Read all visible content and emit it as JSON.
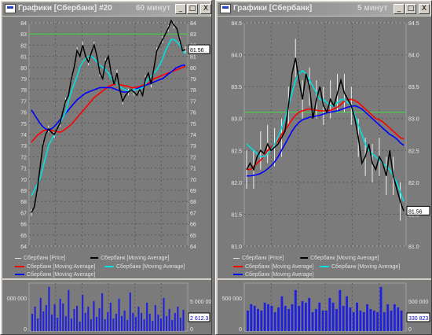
{
  "windows": [
    {
      "title": "Графики [Сбербанк] #20",
      "subtitle": "60 минут",
      "buttons": [
        "_",
        "□",
        "X"
      ],
      "price_label": "81.56",
      "volume_label": "2 612.3",
      "legend": [
        {
          "text": "Сбербанк [Price]",
          "color": "#e0e0e0"
        },
        {
          "text": "Сбербанк [Moving Average]",
          "color": "#000000"
        },
        {
          "text": "Сбербанк [Moving Average]",
          "color": "#ff0000"
        },
        {
          "text": "Сбербанк [Moving Average]",
          "color": "#00e0e0"
        },
        {
          "text": "Сбербанк [Moving Average]",
          "color": "#0000ff"
        }
      ],
      "volume_ticks_left": [
        "000 000",
        "0"
      ],
      "volume_ticks_right": [
        "5 000 00",
        "0"
      ]
    },
    {
      "title": "Графики [Сбербанк]",
      "subtitle": "5 минут",
      "buttons": [
        "_",
        "□",
        "X"
      ],
      "price_label": "81.56",
      "volume_label": "330 823",
      "legend": [
        {
          "text": "Сбербанк [Price]",
          "color": "#e0e0e0"
        },
        {
          "text": "Сбербанк [Moving Average]",
          "color": "#000000"
        },
        {
          "text": "Сбербанк [Moving Average]",
          "color": "#ff0000"
        },
        {
          "text": "Сбербанк [Moving Average]",
          "color": "#00e0e0"
        },
        {
          "text": "Сбербанк [Moving Average]",
          "color": "#0000ff"
        }
      ],
      "volume_ticks_left": [
        "500 000",
        "0"
      ],
      "volume_ticks_right": [
        "500 000",
        "0"
      ]
    }
  ],
  "chart_data": [
    {
      "type": "line",
      "ylim": [
        64,
        84
      ],
      "yticks": [
        "84",
        "83",
        "82",
        "81",
        "80",
        "79",
        "78",
        "77",
        "76",
        "75",
        "74",
        "73",
        "72",
        "71",
        "70",
        "69",
        "68",
        "67",
        "66",
        "65",
        "64"
      ],
      "hline": 83,
      "series": [
        {
          "color": "#000000",
          "values": [
            67,
            67.5,
            69,
            71,
            73,
            74,
            74.5,
            74.2,
            74,
            74.5,
            75,
            76,
            77,
            77.5,
            79,
            80,
            81.5,
            81,
            82,
            81,
            80.5,
            81.3,
            82,
            81,
            79.5,
            79,
            80.5,
            81,
            79.5,
            78.5,
            79.5,
            78,
            77,
            77.5,
            77.8,
            78,
            77.8,
            77.5,
            78,
            77.5,
            79,
            79.5,
            78.5,
            80,
            81.5,
            82,
            82.5,
            83,
            83.5,
            84.2,
            83.8,
            83.5,
            82.5,
            81.5,
            81.6
          ]
        },
        {
          "color": "#00e0e0",
          "values": [
            68.5,
            69,
            69.5,
            70,
            71,
            72,
            73,
            73.5,
            74,
            74.5,
            75,
            75.5,
            76,
            77,
            77.8,
            78.5,
            79.2,
            80,
            80.5,
            80.8,
            81,
            81,
            80.8,
            80.5,
            80.2,
            80,
            79.8,
            79.5,
            79,
            78.8,
            78.5,
            78.3,
            78.1,
            78,
            77.9,
            77.9,
            78,
            78,
            78.1,
            78.2,
            78.5,
            79,
            79.2,
            79.5,
            79.8,
            80.2,
            80.8,
            81.5,
            82,
            82.5,
            82.5,
            82.3,
            82,
            81.6,
            81.2
          ]
        },
        {
          "color": "#ff0000",
          "values": [
            73.3,
            73.6,
            73.9,
            74.1,
            74.3,
            74.4,
            74.4,
            74.35,
            74.3,
            74.25,
            74.2,
            74.3,
            74.5,
            74.7,
            74.9,
            75.2,
            75.5,
            75.8,
            76.1,
            76.4,
            76.7,
            77,
            77.3,
            77.5,
            77.7,
            77.9,
            78.1,
            78.3,
            78.4,
            78.5,
            78.5,
            78.45,
            78.4,
            78.35,
            78.3,
            78.2,
            78.2,
            78.25,
            78.3,
            78.4,
            78.5,
            78.6,
            78.8,
            79,
            79.1,
            79.2,
            79.3,
            79.4,
            79.5,
            79.6,
            79.7,
            79.8,
            79.9,
            80,
            80.1
          ]
        },
        {
          "color": "#0000ff",
          "values": [
            76.2,
            75.8,
            75.4,
            75,
            74.7,
            74.5,
            74.4,
            74.5,
            74.7,
            75,
            75.3,
            75.6,
            75.9,
            76.2,
            76.5,
            76.8,
            77.1,
            77.3,
            77.5,
            77.7,
            77.8,
            77.9,
            78,
            78.1,
            78.2,
            78.2,
            78.2,
            78.2,
            78.2,
            78.1,
            78,
            77.9,
            77.8,
            77.8,
            77.85,
            77.9,
            78,
            78.1,
            78.2,
            78.3,
            78.4,
            78.5,
            78.6,
            78.7,
            78.8,
            78.9,
            79,
            79.2,
            79.4,
            79.6,
            79.8,
            80,
            80.1,
            80.2,
            80.2
          ]
        }
      ],
      "volume": [
        2.2,
        3.1,
        1.6,
        4.2,
        2.5,
        3.3,
        5.6,
        2.1,
        3.4,
        1.7,
        4.1,
        3.5,
        1.9,
        5.2,
        1.6,
        2.8,
        3.2,
        1.2,
        4.6,
        2.3,
        3.1,
        1.5,
        3.8,
        1.8,
        2.9,
        4.8,
        1.5,
        2.4,
        3.6,
        1.6,
        2.2,
        4.1,
        1.9,
        2.6,
        1.4,
        4.9,
        2.3,
        1.8,
        3.1,
        2.3,
        1.5,
        3.6,
        2.2,
        1.3,
        3.3,
        2.1,
        1.6,
        4.2,
        1.9,
        2.8,
        1.4,
        2.3,
        3.1,
        1.7,
        2.7
      ]
    },
    {
      "type": "line",
      "ylim": [
        81.0,
        84.5
      ],
      "yticks": [
        "84.5",
        "84.0",
        "83.5",
        "83.0",
        "82.5",
        "82.0",
        "81.5",
        "81.0"
      ],
      "hline": 83.1,
      "series": [
        {
          "color": "#000000",
          "values": [
            82.2,
            82.3,
            82.2,
            82.4,
            82.5,
            82.45,
            82.6,
            82.5,
            82.55,
            82.6,
            82.7,
            82.8,
            83.2,
            83.7,
            83.95,
            83.6,
            83.3,
            83.7,
            83.5,
            83.0,
            83.3,
            83.5,
            83.2,
            83.1,
            83.3,
            83.2,
            83.4,
            83.6,
            83.4,
            83.3,
            83.2,
            83.0,
            82.7,
            82.3,
            82.4,
            82.6,
            82.3,
            82.2,
            82.4,
            82.3,
            82.1,
            82.5,
            82.1,
            81.9,
            81.7,
            81.55
          ]
        },
        {
          "color": "#00e0e0",
          "values": [
            82.6,
            82.55,
            82.5,
            82.45,
            82.4,
            82.4,
            82.45,
            82.5,
            82.6,
            82.7,
            82.85,
            83.0,
            83.2,
            83.4,
            83.6,
            83.7,
            83.75,
            83.7,
            83.6,
            83.5,
            83.4,
            83.3,
            83.3,
            83.25,
            83.2,
            83.2,
            83.25,
            83.3,
            83.3,
            83.25,
            83.2,
            83.05,
            82.9,
            82.75,
            82.6,
            82.5,
            82.45,
            82.4,
            82.35,
            82.3,
            82.25,
            82.2,
            82.1,
            82.0,
            81.85,
            81.7
          ]
        },
        {
          "color": "#ff0000",
          "values": [
            82.2,
            82.2,
            82.25,
            82.3,
            82.35,
            82.4,
            82.5,
            82.55,
            82.6,
            82.65,
            82.75,
            82.82,
            82.9,
            82.98,
            83.05,
            83.1,
            83.12,
            83.14,
            83.15,
            83.14,
            83.13,
            83.12,
            83.12,
            83.12,
            83.13,
            83.15,
            83.18,
            83.22,
            83.27,
            83.3,
            83.3,
            83.28,
            83.25,
            83.2,
            83.15,
            83.1,
            83.05,
            83.0,
            82.98,
            82.95,
            82.9,
            82.85,
            82.8,
            82.75,
            82.7,
            82.68
          ]
        },
        {
          "color": "#0000ff",
          "values": [
            82.1,
            82.1,
            82.11,
            82.12,
            82.14,
            82.17,
            82.21,
            82.26,
            82.32,
            82.4,
            82.5,
            82.6,
            82.7,
            82.8,
            82.88,
            82.94,
            82.98,
            83.0,
            83.02,
            83.03,
            83.04,
            83.05,
            83.07,
            83.09,
            83.1,
            83.11,
            83.12,
            83.14,
            83.16,
            83.18,
            83.19,
            83.2,
            83.18,
            83.15,
            83.1,
            83.05,
            83.0,
            82.95,
            82.9,
            82.85,
            82.8,
            82.75,
            82.72,
            82.68,
            82.62,
            82.58
          ]
        }
      ],
      "volume": [
        1.3,
        1.7,
        1.6,
        1.4,
        1.3,
        1.8,
        1.7,
        1.6,
        1.2,
        1.5,
        2.2,
        1.6,
        1.4,
        1.7,
        2.6,
        1.6,
        1.9,
        1.8,
        2.1,
        1.2,
        1.4,
        1.8,
        1.3,
        1.3,
        2.1,
        1.8,
        1.4,
        2.6,
        1.6,
        2.2,
        1.5,
        1.2,
        1.8,
        1.3,
        1.2,
        1.7,
        1.4,
        1.3,
        1.2,
        2.8,
        1.2,
        1.7,
        1.3,
        1.7,
        1.5,
        1.3
      ]
    }
  ]
}
